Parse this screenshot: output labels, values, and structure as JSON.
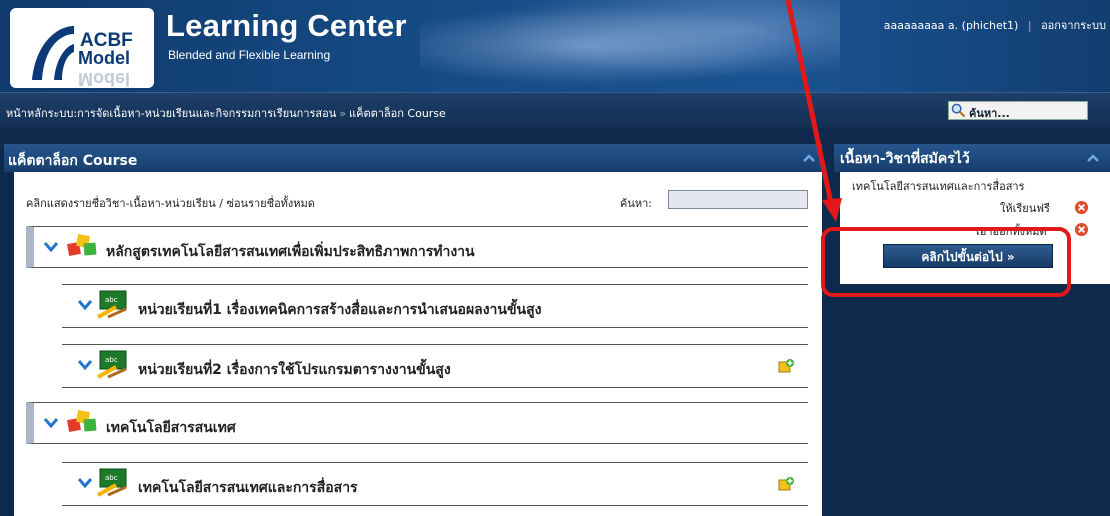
{
  "header": {
    "logo_line1": "ACBF",
    "logo_line2": "Model",
    "logo_mirror": "Model",
    "title": "Learning Center",
    "subtitle": "Blended and Flexible Learning",
    "user": "aaaaaaaaa a. (phichet1)",
    "separator": "|",
    "logout": "ออกจากระบบ"
  },
  "breadcrumb": {
    "home": "หน้าหลักระบบ:การจัดเนื้อหา-หน่วยเรียนและกิจกรรมการเรียนการสอน",
    "sep": "»",
    "current": "แค็ตตาล็อก Course"
  },
  "top_search": {
    "label": "ค้นหา..."
  },
  "catalog": {
    "title": "แค็ตตาล็อก Course",
    "subhead": "คลิกแสดงรายชื่อวิชา-เนื้อหา-หน่วยเรียน / ซ่อนรายชื่อทั้งหมด",
    "search_label": "ค้นหา:",
    "items": [
      {
        "label": "หลักสูตรเทคโนโลยีสารสนเทศเพื่อเพิ่มประสิทธิภาพการทำงาน"
      },
      {
        "label": "หน่วยเรียนที่1 เรื่องเทคนิคการสร้างสื่อและการนำเสนอผลงานขั้นสูง"
      },
      {
        "label": "หน่วยเรียนที่2 เรื่องการใช้โปรแกรมตารางงานขั้นสูง"
      },
      {
        "label": "เทคโนโลยีสารสนเทศ"
      },
      {
        "label": "เทคโนโลยีสารสนเทศและการสื่อสาร"
      }
    ]
  },
  "enrolled": {
    "title": "เนื้อหา-วิชาที่สมัครไว้",
    "course": "เทคโนโลยีสารสนเทศและการสื่อสาร",
    "free": "ให้เรียนฟรี",
    "remove_all": "เอาออกทั้งหมด",
    "next_button": "คลิกไปขั้นต่อไป »"
  },
  "colors": {
    "highlight": "#e31818",
    "header": "#164b85"
  }
}
